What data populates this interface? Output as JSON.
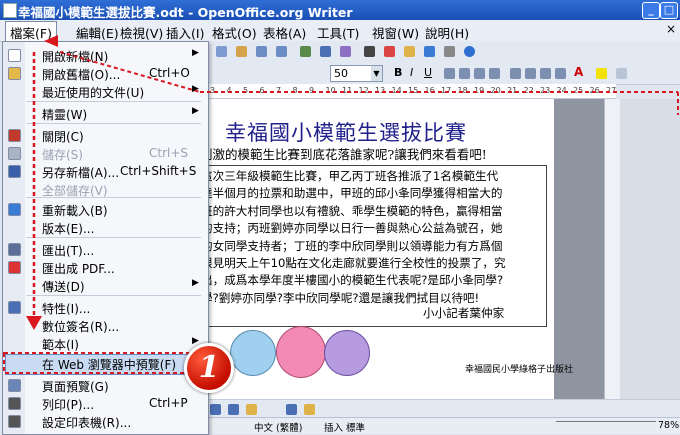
{
  "window": {
    "title": "幸福國小模範生選拔比賽.odt - OpenOffice.org Writer"
  },
  "menubar": {
    "items": [
      "檔案(F)",
      "編輯(E)",
      "檢視(V)",
      "插入(I)",
      "格式(O)",
      "表格(A)",
      "工具(T)",
      "視窗(W)",
      "說明(H)"
    ]
  },
  "toolbar": {
    "font_size": "50"
  },
  "ruler": {
    "ticks": [
      "3",
      "4",
      "5",
      "6",
      "7",
      "8",
      "9",
      "10",
      "11",
      "12",
      "13",
      "14",
      "15",
      "16",
      "17",
      "18",
      "19",
      "20",
      "21",
      "22",
      "23",
      "24",
      "25",
      "26",
      "27"
    ]
  },
  "file_menu": {
    "items": [
      {
        "label": "開啟新檔(N)",
        "shortcut": "",
        "submenu": true,
        "disabled": false,
        "icon": "new-doc-icon",
        "icon_color": "#ffffff"
      },
      {
        "label": "開啟舊檔(O)...",
        "shortcut": "Ctrl+O",
        "submenu": false,
        "disabled": false,
        "icon": "open-folder-icon",
        "icon_color": "#e6b84a"
      },
      {
        "label": "最近使用的文件(U)",
        "shortcut": "",
        "submenu": true,
        "disabled": false,
        "icon": "",
        "icon_color": ""
      },
      {
        "label": "精靈(W)",
        "shortcut": "",
        "submenu": true,
        "disabled": false,
        "icon": "",
        "icon_color": ""
      },
      {
        "label": "關閉(C)",
        "shortcut": "",
        "submenu": false,
        "disabled": false,
        "icon": "close-doc-icon",
        "icon_color": "#c0392b"
      },
      {
        "label": "儲存(S)",
        "shortcut": "Ctrl+S",
        "submenu": false,
        "disabled": true,
        "icon": "save-icon",
        "icon_color": "#aab4c4"
      },
      {
        "label": "另存新檔(A)...",
        "shortcut": "Ctrl+Shift+S",
        "submenu": false,
        "disabled": false,
        "icon": "save-as-icon",
        "icon_color": "#3a5fa8"
      },
      {
        "label": "全部儲存(V)",
        "shortcut": "",
        "submenu": false,
        "disabled": true,
        "icon": "",
        "icon_color": ""
      },
      {
        "label": "重新載入(B)",
        "shortcut": "",
        "submenu": false,
        "disabled": false,
        "icon": "reload-icon",
        "icon_color": "#3a7bd5"
      },
      {
        "label": "版本(E)...",
        "shortcut": "",
        "submenu": false,
        "disabled": false,
        "icon": "",
        "icon_color": ""
      },
      {
        "label": "匯出(T)...",
        "shortcut": "",
        "submenu": false,
        "disabled": false,
        "icon": "export-icon",
        "icon_color": "#5b6f99"
      },
      {
        "label": "匯出成 PDF...",
        "shortcut": "",
        "submenu": false,
        "disabled": false,
        "icon": "pdf-icon",
        "icon_color": "#d33"
      },
      {
        "label": "傳送(D)",
        "shortcut": "",
        "submenu": true,
        "disabled": false,
        "icon": "",
        "icon_color": ""
      },
      {
        "label": "特性(I)...",
        "shortcut": "",
        "submenu": false,
        "disabled": false,
        "icon": "properties-icon",
        "icon_color": "#4a6fb5"
      },
      {
        "label": "數位簽名(R)...",
        "shortcut": "",
        "submenu": false,
        "disabled": false,
        "icon": "",
        "icon_color": ""
      },
      {
        "label": "範本(I)",
        "shortcut": "",
        "submenu": true,
        "disabled": false,
        "icon": "",
        "icon_color": ""
      },
      {
        "label": "在 Web 瀏覽器中預覽(F)",
        "shortcut": "",
        "submenu": false,
        "disabled": false,
        "icon": "",
        "icon_color": ""
      },
      {
        "label": "頁面預覽(G)",
        "shortcut": "",
        "submenu": false,
        "disabled": false,
        "icon": "page-preview-icon",
        "icon_color": "#6a86b8"
      },
      {
        "label": "列印(P)...",
        "shortcut": "Ctrl+P",
        "submenu": false,
        "disabled": false,
        "icon": "print-icon",
        "icon_color": "#555"
      },
      {
        "label": "設定印表機(R)...",
        "shortcut": "",
        "submenu": false,
        "disabled": false,
        "icon": "printer-setup-icon",
        "icon_color": "#555"
      }
    ]
  },
  "document": {
    "title": "幸福國小模範生選拔比賽",
    "subtitle": "刺激的模範生比賽到底花落誰家呢?讓我們來看看吧!",
    "body": "這次三年級模範生比賽，甲乙丙丁班各推派了1名模範生代\n達半個月的拉票和助選中，甲班的邱小夆同學獲得相當大的\n班的許大村同學也以有禮貌、乖學生模範的特色，贏得相當\n的支持；丙班劉婷亦同學以日行一善與熱心公益為號召，她\n的女同學支持者；丁班的李中欣同學則以領導能力有方爲個\n限見明天上午10點在文化走廊就要進行全校性的投票了，究\n出，成爲本學年度半樓國小的模範生代表呢?是邱小夆同學?\n學?劉婷亦同學?李中欣同學呢?還是讓我們拭目以待吧!",
    "signature": "小小記者葉仲家",
    "footer": "幸福國民小學綠格子出版社"
  },
  "statusbar": {
    "language": "中文 (繁體)",
    "insert_mode": "插入",
    "selection_mode": "標準",
    "zoom": "78%"
  },
  "annotation": {
    "badge": "1"
  }
}
